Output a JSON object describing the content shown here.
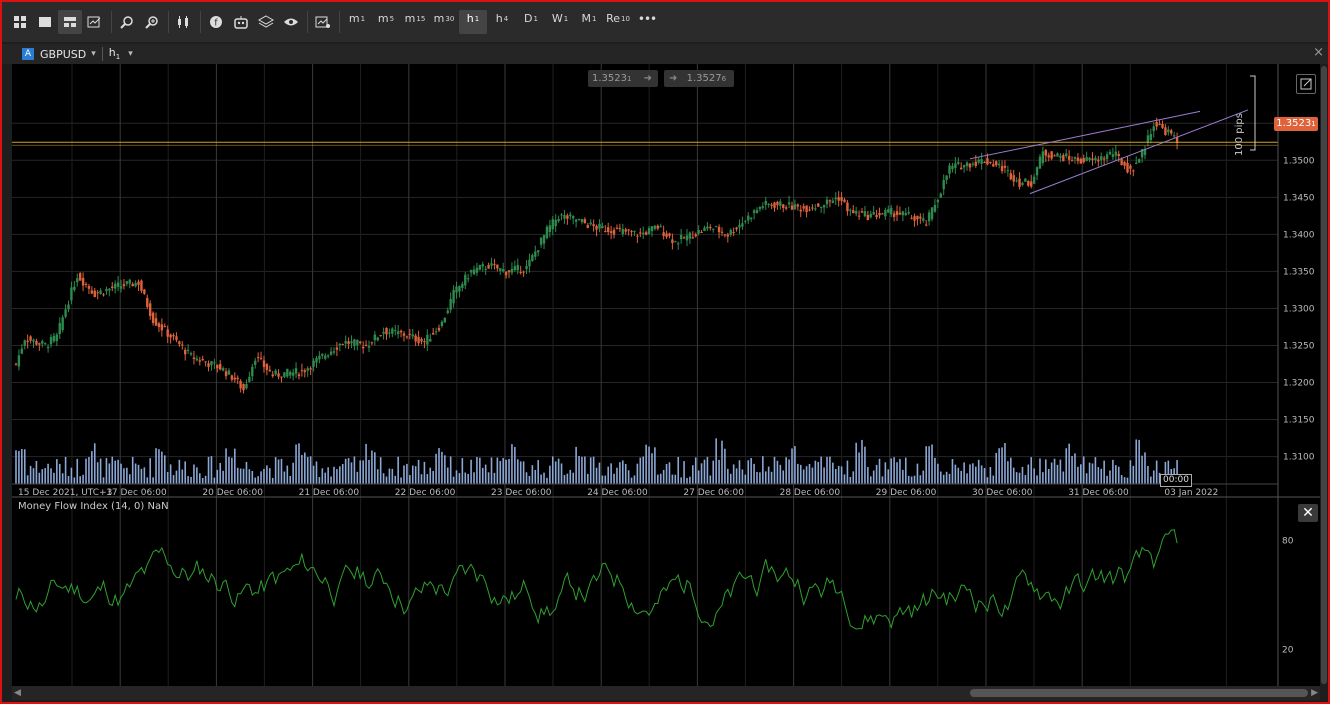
{
  "toolbar": {
    "icons": [
      "workspace-grid-icon",
      "single-chart-icon",
      "multi-chart-icon",
      "chart-edit-icon",
      "zoom-out-icon",
      "zoom-in-icon",
      "candlestick-type-icon",
      "symbol-icon",
      "bot-icon",
      "layers-icon",
      "eye-icon",
      "drawing-settings-icon"
    ],
    "timeframes": [
      {
        "main": "m",
        "sub": "1"
      },
      {
        "main": "m",
        "sub": "5"
      },
      {
        "main": "m",
        "sub": "15"
      },
      {
        "main": "m",
        "sub": "30"
      },
      {
        "main": "h",
        "sub": "1",
        "active": true
      },
      {
        "main": "h",
        "sub": "4"
      },
      {
        "main": "D",
        "sub": "1"
      },
      {
        "main": "W",
        "sub": "1"
      },
      {
        "main": "M",
        "sub": "1"
      },
      {
        "main": "Re",
        "sub": "10"
      }
    ],
    "more_label": "•••"
  },
  "tab": {
    "symbol_badge": "A",
    "symbol": "GBPUSD",
    "symbol_caret": "▾",
    "timeframe_main": "h",
    "timeframe_sub": "1",
    "timeframe_caret": "▾",
    "close_label": "×"
  },
  "chart": {
    "bid_box": "1.3523",
    "bid_box_small": "1",
    "ask_box": "1.3527",
    "ask_box_small": "6",
    "price_label": "1.3523",
    "price_label_small": "1",
    "pips_label": "100 pips",
    "current_time_label": "00:00",
    "indicator_title": "Money Flow Index (14, 0) NaN",
    "colors": {
      "up": "#2e8b4e",
      "down": "#e0623b",
      "volume": "#8aa7d6",
      "mfi": "#2fa12f",
      "price_line": "#c9a227",
      "channel": "#9b7fd1",
      "price_tag": "#e0623b"
    }
  },
  "chart_data": [
    {
      "type": "candlestick",
      "title": "GBPUSD h1",
      "x_labels": [
        "15 Dec 2021, UTC+3",
        "17 Dec 06:00",
        "20 Dec 06:00",
        "21 Dec 06:00",
        "22 Dec 06:00",
        "23 Dec 06:00",
        "24 Dec 06:00",
        "27 Dec 06:00",
        "28 Dec 06:00",
        "29 Dec 06:00",
        "30 Dec 06:00",
        "31 Dec 06:00",
        "03 Jan 2022"
      ],
      "y_ticks": [
        "1.3550",
        "1.3500",
        "1.3450",
        "1.3400",
        "1.3350",
        "1.3300",
        "1.3250",
        "1.3200",
        "1.3150",
        "1.3100"
      ],
      "ylim": [
        1.3063,
        1.363
      ],
      "anchors": [
        [
          0,
          1.3225
        ],
        [
          3,
          1.326
        ],
        [
          10,
          1.325
        ],
        [
          14,
          1.3262
        ],
        [
          17,
          1.33
        ],
        [
          21,
          1.3345
        ],
        [
          27,
          1.332
        ],
        [
          35,
          1.333
        ],
        [
          42,
          1.3335
        ],
        [
          47,
          1.3285
        ],
        [
          55,
          1.3255
        ],
        [
          60,
          1.3235
        ],
        [
          70,
          1.322
        ],
        [
          75,
          1.3205
        ],
        [
          78,
          1.319
        ],
        [
          82,
          1.3235
        ],
        [
          88,
          1.321
        ],
        [
          98,
          1.3215
        ],
        [
          105,
          1.3235
        ],
        [
          112,
          1.3255
        ],
        [
          120,
          1.325
        ],
        [
          126,
          1.327
        ],
        [
          133,
          1.3265
        ],
        [
          140,
          1.3255
        ],
        [
          146,
          1.328
        ],
        [
          150,
          1.332
        ],
        [
          156,
          1.335
        ],
        [
          162,
          1.3358
        ],
        [
          168,
          1.335
        ],
        [
          175,
          1.3355
        ],
        [
          182,
          1.3405
        ],
        [
          186,
          1.3425
        ],
        [
          192,
          1.342
        ],
        [
          198,
          1.341
        ],
        [
          206,
          1.3405
        ],
        [
          214,
          1.34
        ],
        [
          220,
          1.341
        ],
        [
          226,
          1.339
        ],
        [
          232,
          1.34
        ],
        [
          238,
          1.341
        ],
        [
          244,
          1.34
        ],
        [
          250,
          1.342
        ],
        [
          256,
          1.344
        ],
        [
          262,
          1.344
        ],
        [
          270,
          1.3435
        ],
        [
          276,
          1.344
        ],
        [
          282,
          1.345
        ],
        [
          286,
          1.343
        ],
        [
          292,
          1.3425
        ],
        [
          300,
          1.343
        ],
        [
          306,
          1.3425
        ],
        [
          312,
          1.3415
        ],
        [
          316,
          1.345
        ],
        [
          320,
          1.349
        ],
        [
          326,
          1.3495
        ],
        [
          332,
          1.35
        ],
        [
          338,
          1.349
        ],
        [
          344,
          1.347
        ],
        [
          348,
          1.347
        ],
        [
          352,
          1.351
        ],
        [
          358,
          1.3505
        ],
        [
          364,
          1.35
        ],
        [
          370,
          1.35
        ],
        [
          376,
          1.351
        ],
        [
          382,
          1.3485
        ],
        [
          386,
          1.351
        ],
        [
          390,
          1.355
        ],
        [
          396,
          1.3535
        ],
        [
          398,
          1.3523
        ]
      ],
      "mfi_ylim": [
        0,
        100
      ],
      "mfi_ticks": [
        "80",
        "20"
      ],
      "volume_note": "volume histogram"
    }
  ]
}
